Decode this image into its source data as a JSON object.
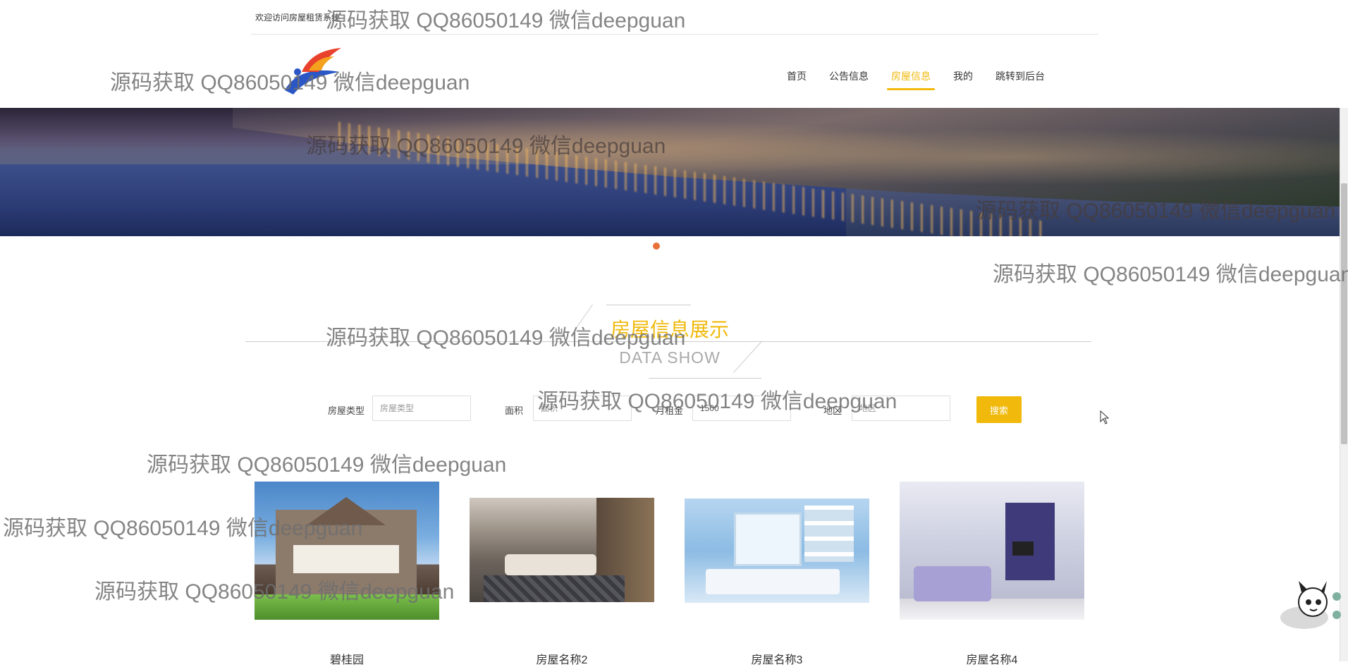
{
  "topbar": {
    "welcome": "欢迎访问房屋租赁系统"
  },
  "nav": {
    "items": [
      {
        "label": "首页"
      },
      {
        "label": "公告信息"
      },
      {
        "label": "房屋信息",
        "active": true
      },
      {
        "label": "我的"
      },
      {
        "label": "跳转到后台"
      }
    ]
  },
  "section": {
    "title": "房屋信息展示",
    "subtitle": "DATA SHOW"
  },
  "search": {
    "type_label": "房屋类型",
    "type_placeholder": "房屋类型",
    "type_value": "",
    "area_label": "面积",
    "area_placeholder": "面积",
    "area_value": "",
    "rent_label": "月租金",
    "rent_placeholder": "月租金",
    "rent_value": "1500",
    "region_label": "地区",
    "region_placeholder": "地区",
    "region_value": "",
    "button_label": "搜索"
  },
  "cards": [
    {
      "title": "碧桂园"
    },
    {
      "title": "房屋名称2"
    },
    {
      "title": "房屋名称3"
    },
    {
      "title": "房屋名称4"
    }
  ],
  "watermark": "源码获取 QQ86050149 微信deepguan",
  "colors": {
    "accent": "#f0b90b",
    "carousel_dot": "#e8703a"
  }
}
